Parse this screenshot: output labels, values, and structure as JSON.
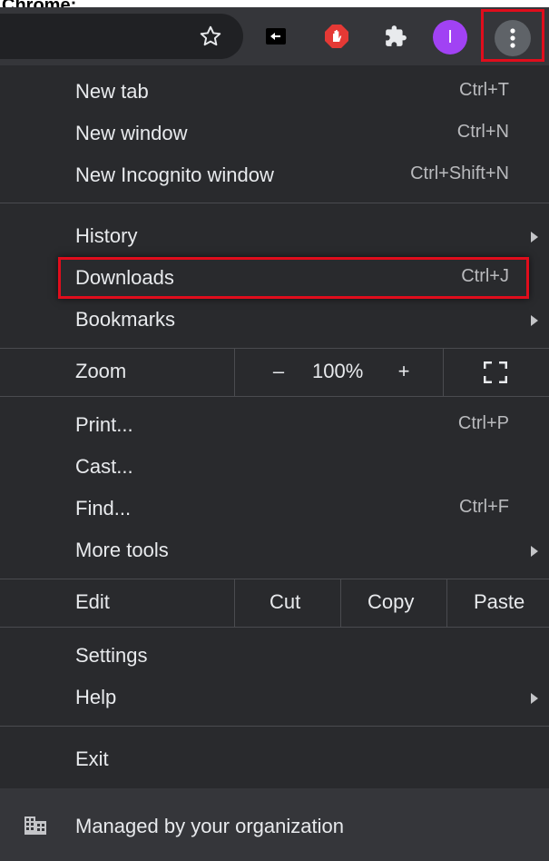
{
  "caption": "Chrome:",
  "toolbar": {
    "icons": [
      "star-icon",
      "extension-box-icon",
      "adblock-hand-icon",
      "puzzle-extensions-icon",
      "profile-avatar",
      "kebab-menu-icon"
    ],
    "avatar_letter": "I",
    "colors": {
      "toolbar_bg": "#35363a",
      "omnibox_bg": "#202124",
      "avatar": "#a142f4",
      "adblock": "#e53935",
      "highlight": "#e00d1c"
    }
  },
  "menu": {
    "new_tab": {
      "label": "New tab",
      "shortcut": "Ctrl+T"
    },
    "new_window": {
      "label": "New window",
      "shortcut": "Ctrl+N"
    },
    "incognito": {
      "label": "New Incognito window",
      "shortcut": "Ctrl+Shift+N"
    },
    "history": {
      "label": "History"
    },
    "downloads": {
      "label": "Downloads",
      "shortcut": "Ctrl+J"
    },
    "bookmarks": {
      "label": "Bookmarks"
    },
    "zoom": {
      "label": "Zoom",
      "minus": "–",
      "value": "100%",
      "plus": "+"
    },
    "print": {
      "label": "Print...",
      "shortcut": "Ctrl+P"
    },
    "cast": {
      "label": "Cast..."
    },
    "find": {
      "label": "Find...",
      "shortcut": "Ctrl+F"
    },
    "more_tools": {
      "label": "More tools"
    },
    "edit": {
      "label": "Edit",
      "cut": "Cut",
      "copy": "Copy",
      "paste": "Paste"
    },
    "settings": {
      "label": "Settings"
    },
    "help": {
      "label": "Help"
    },
    "exit": {
      "label": "Exit"
    },
    "managed": {
      "label": "Managed by your organization",
      "icon": "building-icon"
    }
  }
}
